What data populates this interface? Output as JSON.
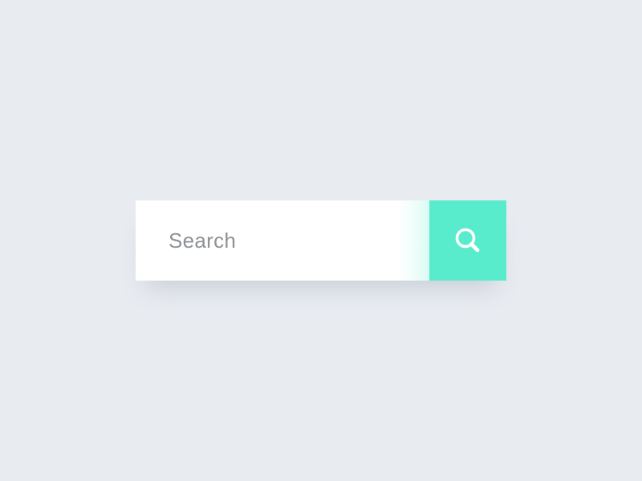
{
  "search": {
    "placeholder": "Search",
    "value": "",
    "button_icon": "search-icon"
  },
  "colors": {
    "background": "#E8EBF0",
    "field": "#FFFFFF",
    "accent": "#58ECCD",
    "icon": "#FFFFFF",
    "placeholder": "#8E9296"
  }
}
